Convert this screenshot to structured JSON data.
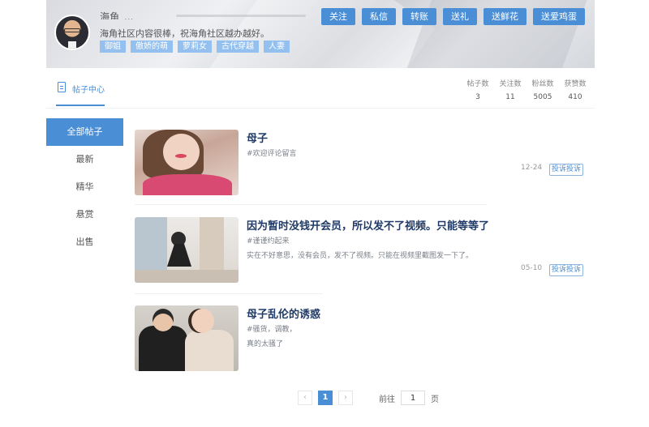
{
  "profile": {
    "username": "海角_...",
    "intro": "海角社区内容很棒，祝海角社区越办越好。",
    "tags": [
      "御姐",
      "傲娇的萌",
      "萝莉女",
      "古代穿越",
      "人妻"
    ]
  },
  "actions": [
    "关注",
    "私信",
    "转账",
    "送礼",
    "送鲜花",
    "送爱鸡蛋"
  ],
  "subhead": {
    "tab_label": "帖子中心",
    "stats": [
      {
        "label": "帖子数",
        "value": "3"
      },
      {
        "label": "关注数",
        "value": "11"
      },
      {
        "label": "粉丝数",
        "value": "5005"
      },
      {
        "label": "获赞数",
        "value": "410"
      }
    ]
  },
  "nav": [
    "全部帖子",
    "最新",
    "精华",
    "悬赏",
    "出售"
  ],
  "posts": [
    {
      "title": "母子",
      "tag": "#欢迎评论留言",
      "desc": "",
      "date": "12-24",
      "report": "投诉投诉"
    },
    {
      "title": "因为暂时没钱开会员，所以发不了视频。只能等等了",
      "tag": "#谨谨约起来",
      "desc": "实在不好意思，没有会员，发不了视频。只能在视频里截图发一下了。",
      "date": "05-10",
      "report": "投诉投诉"
    },
    {
      "title": "母子乱伦的诱惑",
      "tag": "#骚货，调教，",
      "desc": "真的太骚了",
      "date": "",
      "report": ""
    }
  ],
  "pagination": {
    "prev": "‹",
    "current": "1",
    "next": "›",
    "goto_label": "前往",
    "goto_value": "1",
    "page_suffix": "页"
  }
}
